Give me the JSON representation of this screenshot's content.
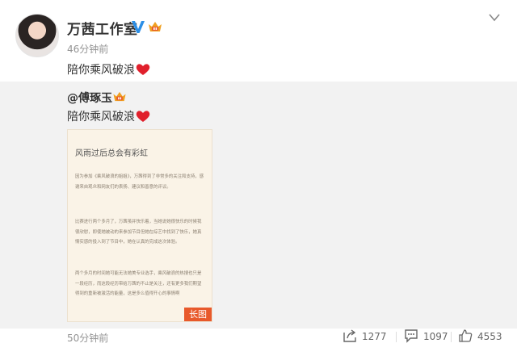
{
  "post": {
    "author": "万茜工作室",
    "time": "46分钟前",
    "text": "陪你乘风破浪",
    "heart_icon": "red-heart-icon"
  },
  "repost": {
    "author": "@傅琢玉",
    "text": "陪你乘风破浪",
    "long_image": {
      "title": "风雨过后总会有彩虹",
      "paragraphs": [
        "因为参加《乘风破浪的姐姐》，万茜得到了非常多的关注和支持，感谢来自观众和网友们的表扬、建议和善意的评议。",
        "比赛进行两个多月了，万茜虽并快乐着，当她说她很快乐的时候我很欣慰，即使她被动的来参加节目但她在综艺中找到了快乐，她真情实感的投入到了节目中，她在认真的完成这次体验。",
        "两个多月的时间她可能无法她美专业选手，乘风破浪的热搜也只是一段经历，而这段经历带给万茜的不止是关注，还有更多我们期望得到的重新被激活的能量，这是多么值得开心的事情啊"
      ],
      "tag": "长图"
    }
  },
  "footer": {
    "time": "50分钟前",
    "share_count": "1277",
    "comment_count": "1097",
    "like_count": "4553"
  },
  "colors": {
    "accent_orange": "#e8592b",
    "verified_blue": "#2d8fe6",
    "crown_gold": "#f0a020",
    "heart_red": "#e0202c"
  }
}
